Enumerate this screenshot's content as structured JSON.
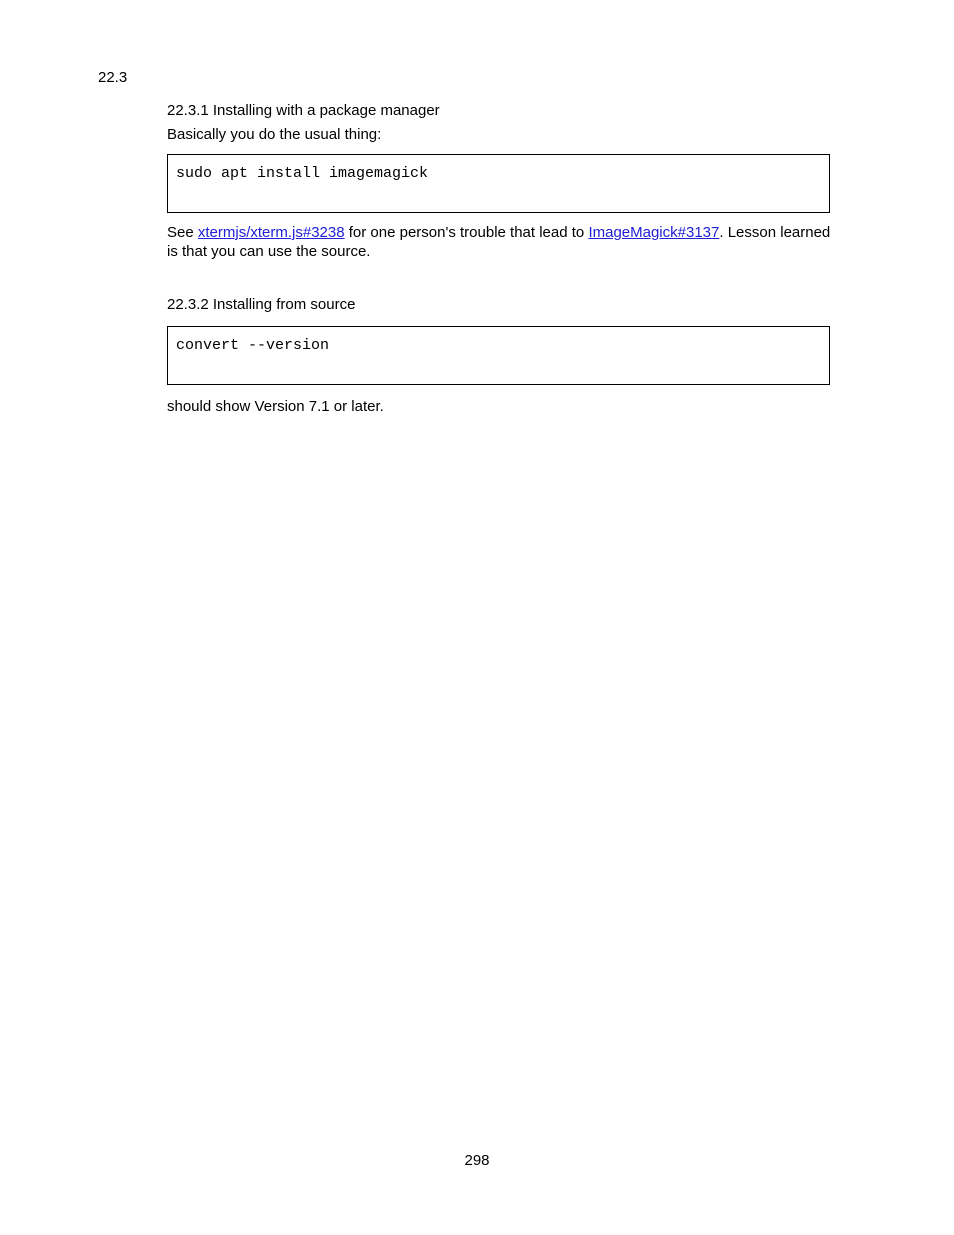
{
  "sidebar": {
    "section_number": "22.3"
  },
  "headings": {
    "h1": "22.3.1 Installing with a package manager",
    "h2": "22.3.2 Installing from source"
  },
  "para1": "Basically you do the usual thing:",
  "code1": "sudo apt install imagemagick",
  "para2": {
    "pre": "See ",
    "link1": "xtermjs/xterm.js#3238",
    "mid": " for one person's trouble that lead to ",
    "link2": "ImageMagick#3137",
    "post": ". Lesson learned is that you can use the source."
  },
  "code2": "convert --version",
  "para3": "should show Version 7.1 or later.",
  "page_number": "298"
}
